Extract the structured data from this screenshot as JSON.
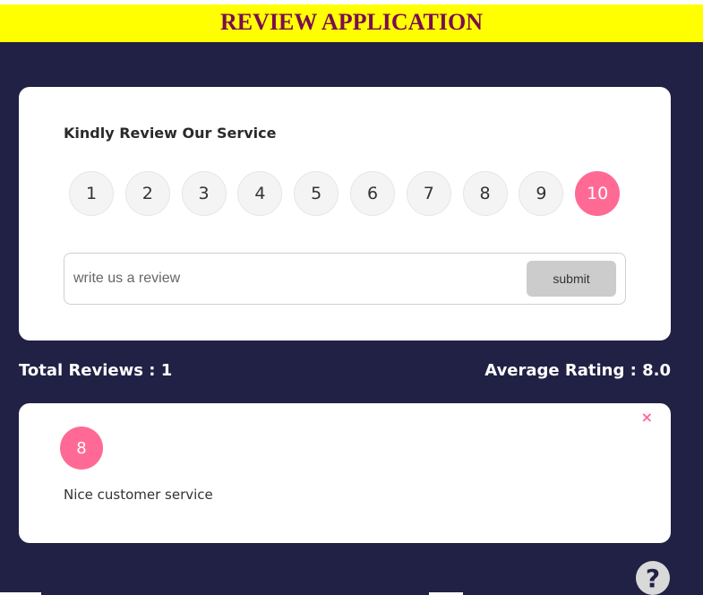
{
  "header": {
    "title": "REVIEW APPLICATION"
  },
  "review_form": {
    "title": "Kindly Review Our Service",
    "ratings": [
      "1",
      "2",
      "3",
      "4",
      "5",
      "6",
      "7",
      "8",
      "9",
      "10"
    ],
    "selected_rating": "10",
    "input": {
      "placeholder": "write us a review",
      "value": ""
    },
    "submit_label": "submit"
  },
  "stats": {
    "total_reviews": "Total Reviews : 1",
    "average_rating": "Average Rating : 8.0"
  },
  "reviews": [
    {
      "rating": "8",
      "text": "Nice customer service",
      "close_icon": "×"
    }
  ],
  "help": {
    "icon": "?"
  },
  "colors": {
    "background": "#212145",
    "header": "#ffff00",
    "title": "#7a0d52",
    "accent": "#ff6a95"
  }
}
